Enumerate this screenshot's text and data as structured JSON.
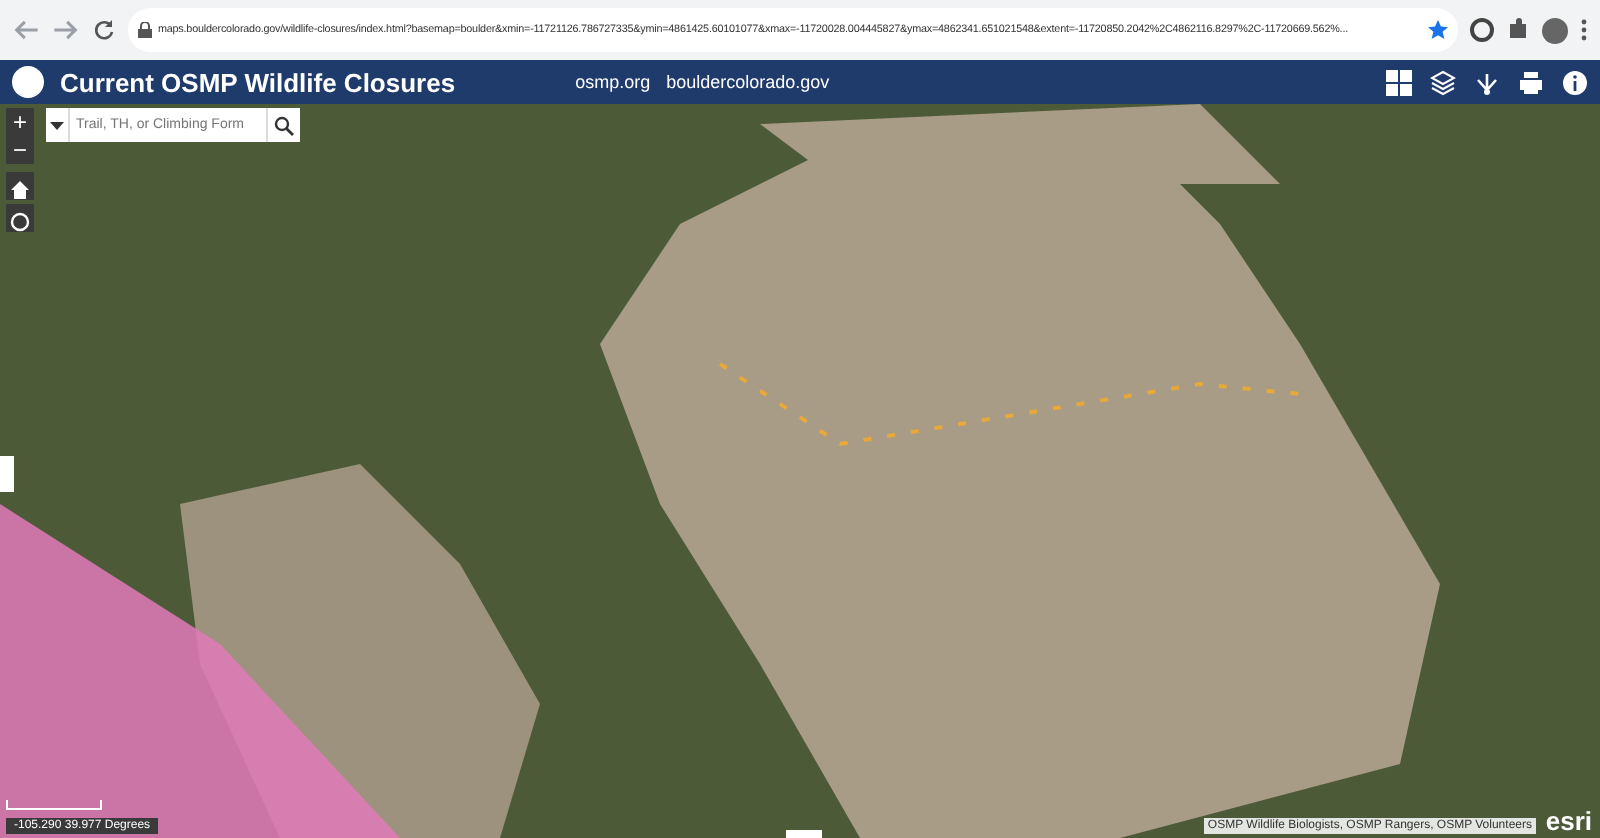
{
  "browser": {
    "url": "maps.bouldercolorado.gov/wildlife-closures/index.html?basemap=boulder&xmin=-11721126.786727335&ymin=4861425.60101077&xmax=-11720028.004445827&ymax=4862341.651021548&extent=-11720850.2042%2C4862116.8297%2C-11720669.562%..."
  },
  "header": {
    "title": "Current OSMP Wildlife Closures",
    "links": [
      "osmp.org",
      "bouldercolorado.gov"
    ]
  },
  "map": {
    "zoom_in": "+",
    "zoom_out": "−",
    "search": {
      "placeholder": "Trail, TH, or Climbing Form"
    },
    "coordinates": "-105.290 39.977 Degrees",
    "attribution": "OSMP Wildlife Biologists, OSMP Rangers, OSMP Volunteers",
    "logo": "esri"
  }
}
